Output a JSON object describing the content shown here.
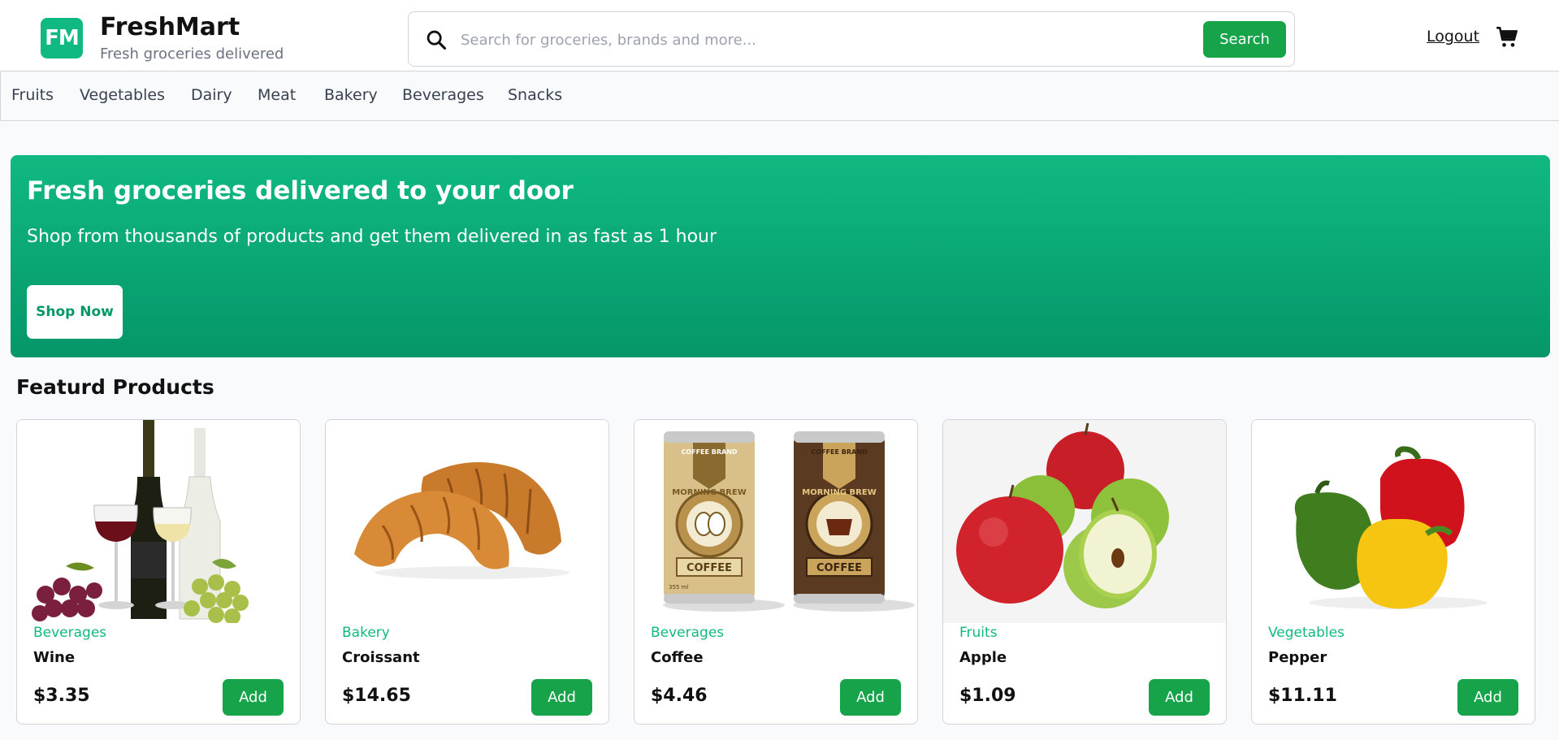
{
  "header": {
    "logo_initials": "FM",
    "brand_name": "FreshMart",
    "tagline": "Fresh groceries delivered",
    "search": {
      "placeholder": "Search for groceries, brands and more...",
      "value": "",
      "button_label": "Search",
      "icon": "search-icon"
    },
    "logout_label": "Logout",
    "cart_icon": "cart-icon"
  },
  "nav": {
    "items": [
      {
        "label": "Fruits"
      },
      {
        "label": "Vegetables"
      },
      {
        "label": "Dairy"
      },
      {
        "label": "Meat"
      },
      {
        "label": "Bakery"
      },
      {
        "label": "Beverages"
      },
      {
        "label": "Snacks"
      }
    ]
  },
  "hero": {
    "title": "Fresh groceries delivered to your door",
    "subtitle": "Shop from thousands of products and get them delivered in as fast as 1 hour",
    "button_label": "Shop Now"
  },
  "featured": {
    "title": "Featurd Products",
    "products": [
      {
        "category": "Beverages",
        "name": "Wine",
        "price": "$3.35",
        "add_label": "Add",
        "image": "wine-image"
      },
      {
        "category": "Bakery",
        "name": "Croissant",
        "price": "$14.65",
        "add_label": "Add",
        "image": "croissant-image"
      },
      {
        "category": "Beverages",
        "name": "Coffee",
        "price": "$4.46",
        "add_label": "Add",
        "image": "coffee-cans-image",
        "image_text": {
          "brand": "COFFEE BRAND",
          "product": "MORNING BREW",
          "label": "COFFEE",
          "volume": "355 ml"
        }
      },
      {
        "category": "Fruits",
        "name": "Apple",
        "price": "$1.09",
        "add_label": "Add",
        "image": "apple-image"
      },
      {
        "category": "Vegetables",
        "name": "Pepper",
        "price": "$11.11",
        "add_label": "Add",
        "image": "pepper-image"
      }
    ]
  },
  "colors": {
    "brand": "#10b981",
    "button_green": "#16a34a",
    "hero_dark": "#059669"
  }
}
